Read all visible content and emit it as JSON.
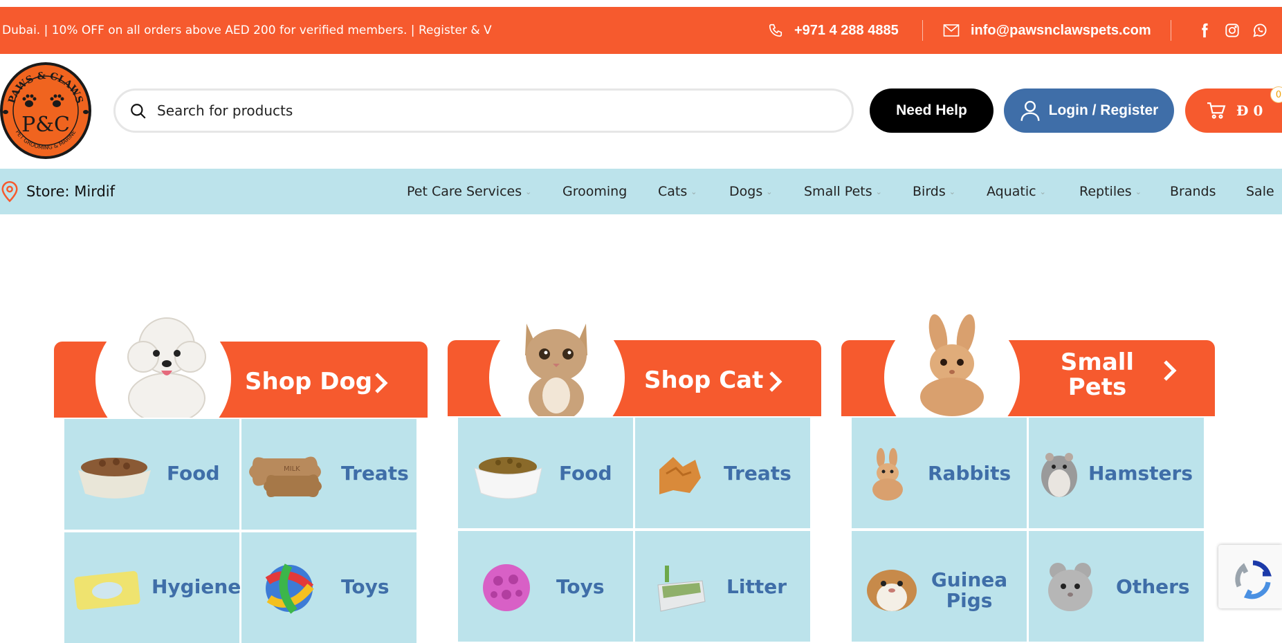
{
  "topbar": {
    "announcement": "Dubai. | 10% OFF on all orders above AED 200 for verified members. | Register & V",
    "phone": "+971 4 288 4885",
    "email": "info@pawsnclawspets.com",
    "social": [
      "facebook-icon",
      "instagram-icon",
      "whatsapp-icon"
    ]
  },
  "logo": {
    "top_text": "PAWS & CLAWS",
    "monogram": "P&C",
    "bottom_text": "PET GROOMING & MARINE"
  },
  "search": {
    "placeholder": "Search for products"
  },
  "buttons": {
    "help": "Need Help",
    "login": "Login / Register",
    "cart_amount": "Đ 0",
    "cart_count": "0"
  },
  "store": {
    "label": "Store: Mirdif"
  },
  "nav": [
    {
      "label": "Pet Care Services",
      "dropdown": true
    },
    {
      "label": "Grooming",
      "dropdown": false
    },
    {
      "label": "Cats",
      "dropdown": true
    },
    {
      "label": "Dogs",
      "dropdown": true
    },
    {
      "label": "Small Pets",
      "dropdown": true
    },
    {
      "label": "Birds",
      "dropdown": true
    },
    {
      "label": "Aquatic",
      "dropdown": true
    },
    {
      "label": "Reptiles",
      "dropdown": true
    },
    {
      "label": "Brands",
      "dropdown": false
    },
    {
      "label": "Sale",
      "dropdown": false
    }
  ],
  "categories": [
    {
      "title": "Shop Dog",
      "animal": "dog",
      "tiles": [
        "Food",
        "Treats",
        "Hygiene",
        "Toys"
      ]
    },
    {
      "title": "Shop Cat",
      "animal": "cat",
      "tiles": [
        "Food",
        "Treats",
        "Toys",
        "Litter"
      ]
    },
    {
      "title": "Small Pets",
      "animal": "rabbit",
      "tiles": [
        "Rabbits",
        "Hamsters",
        "Guinea Pigs",
        "Others"
      ]
    }
  ],
  "colors": {
    "brand_orange": "#f65a2e",
    "nav_blue": "#bce3eb",
    "login_blue": "#3f6ea8",
    "text_blue": "#3f6ea8"
  }
}
